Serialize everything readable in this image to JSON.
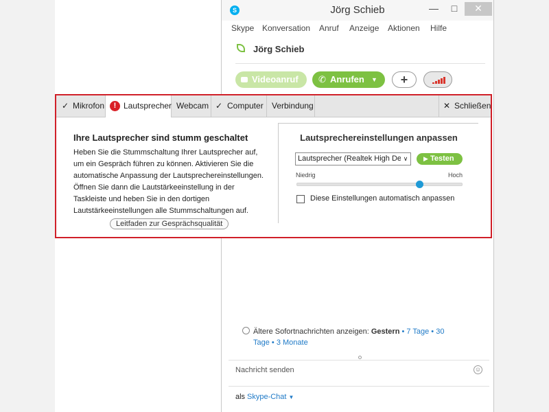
{
  "window": {
    "title": "Jörg Schieb"
  },
  "menu": [
    "Skype",
    "Konversation",
    "Anruf",
    "Anzeige",
    "Aktionen",
    "Hilfe"
  ],
  "contact": {
    "name": "Jörg Schieb"
  },
  "actions": {
    "video_label": "Videoanruf",
    "call_label": "Anrufen",
    "add_symbol": "+"
  },
  "call_quality": {
    "tabs": [
      {
        "label": "Mikrofon",
        "status": "ok"
      },
      {
        "label": "Lautsprecher",
        "status": "warning"
      },
      {
        "label": "Webcam",
        "status": "none"
      },
      {
        "label": "Computer",
        "status": "ok"
      },
      {
        "label": "Verbindung",
        "status": "none"
      }
    ],
    "close_label": "Schließen",
    "heading": "Ihre Lautsprecher sind stumm geschaltet",
    "body": "Heben Sie die Stummschaltung Ihrer Lautsprecher auf, um ein Gespräch führen zu können. Aktivieren Sie die automatische Anpassung der Lautsprechereinstellungen. Öffnen Sie dann die Lautstärkeeinstellung in der Taskleiste und heben Sie in den dortigen Lautstärkeeinstellungen alle Stummschaltungen auf.",
    "guide_link": "Leitfaden zur Gesprächsqualität",
    "settings": {
      "title": "Lautsprechereinstellungen anpassen",
      "device_value": "Lautsprecher (Realtek High De",
      "test_label": "Testen",
      "low_label": "Niedrig",
      "high_label": "Hoch",
      "volume_level": 0.74,
      "auto_adjust_label": "Diese Einstellungen automatisch anpassen",
      "auto_adjust_checked": false
    }
  },
  "history": {
    "prefix": "Ältere Sofortnachrichten anzeigen:",
    "current": "Gestern",
    "links": [
      "7 Tage",
      "30 Tage",
      "3 Monate"
    ],
    "separator": "•"
  },
  "composer": {
    "placeholder": "Nachricht senden",
    "as_label": "als",
    "mode": "Skype-Chat"
  },
  "colors": {
    "accent_green": "#7dc142",
    "skype_blue": "#00aff0",
    "alert_red": "#d01f28",
    "link_blue": "#1f7ac7",
    "slider_blue": "#1f9ad6"
  },
  "icons": [
    "skype-logo-icon",
    "minimize-icon",
    "maximize-icon",
    "close-icon",
    "contact-status-icon",
    "video-camera-icon",
    "phone-icon",
    "chevron-down-icon",
    "plus-icon",
    "signal-bars-icon",
    "check-icon",
    "warning-icon",
    "play-icon",
    "clock-icon",
    "emoticon-icon"
  ]
}
